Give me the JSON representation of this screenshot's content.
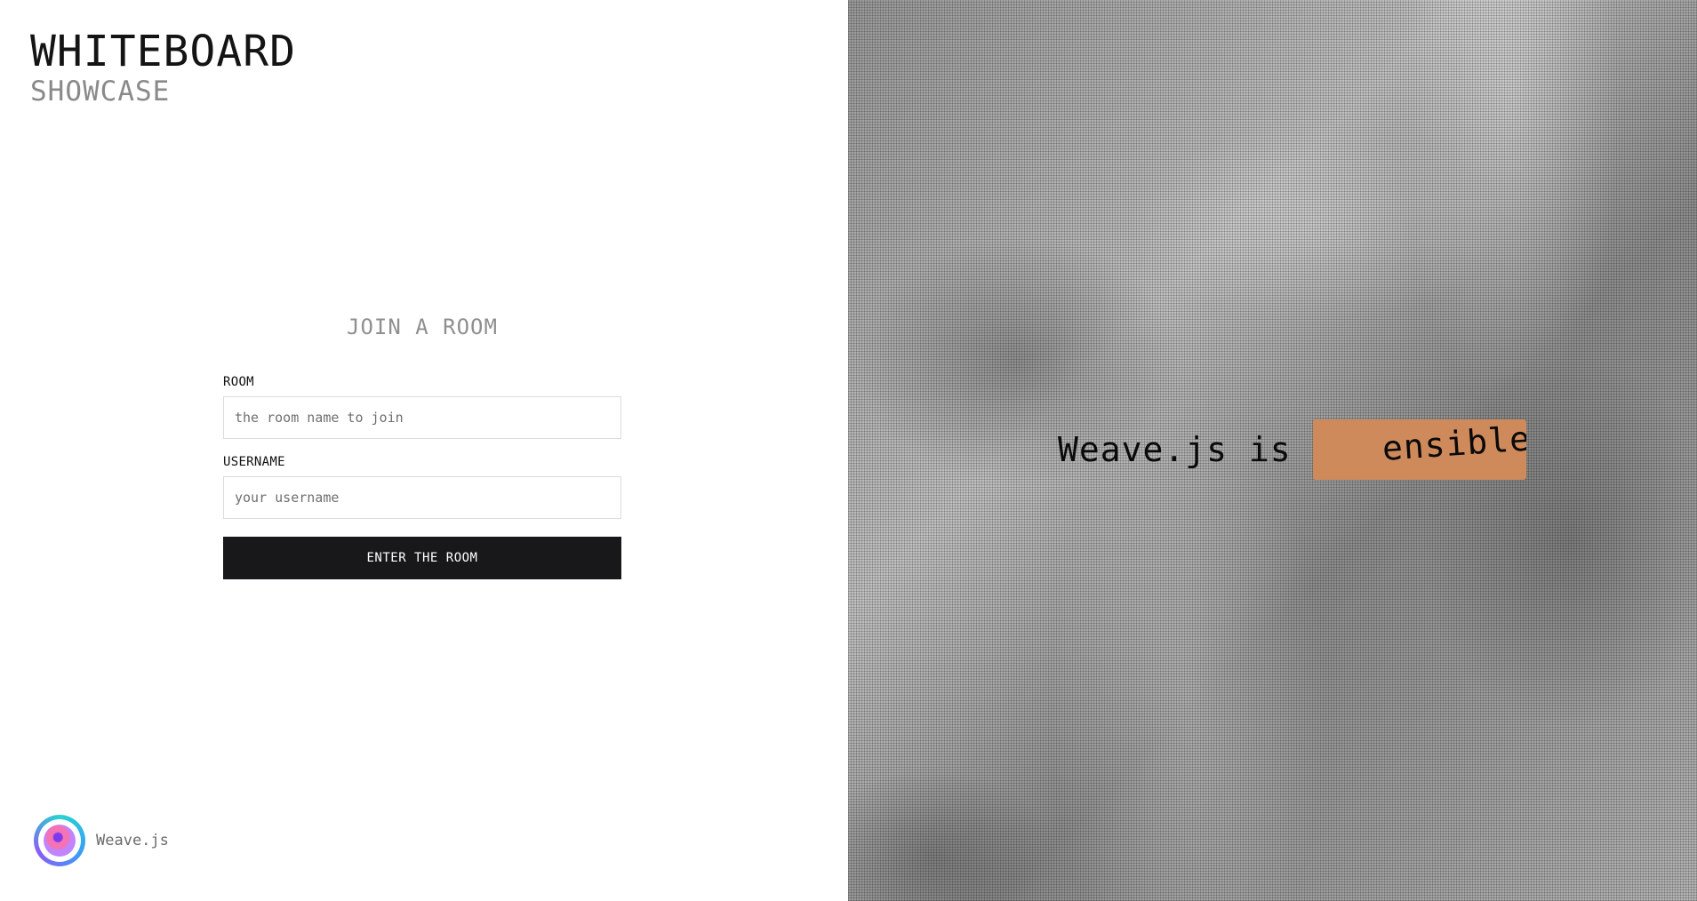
{
  "brand": {
    "title": "WHITEBOARD",
    "subtitle": "SHOWCASE"
  },
  "form": {
    "title": "JOIN A ROOM",
    "room_label": "ROOM",
    "room_placeholder": "the room name to join",
    "room_value": "",
    "username_label": "USERNAME",
    "username_placeholder": "your username",
    "username_value": "",
    "submit_label": "ENTER THE ROOM"
  },
  "footer": {
    "logo_icon": "weavejs-logo-icon",
    "name": "Weave.js"
  },
  "hero": {
    "text": "Weave.js is",
    "rotating_word": "ensible"
  },
  "colors": {
    "button_bg": "#18181b",
    "chip_bg": "#cf8a5b",
    "placeholder": "#6f6f6f"
  }
}
